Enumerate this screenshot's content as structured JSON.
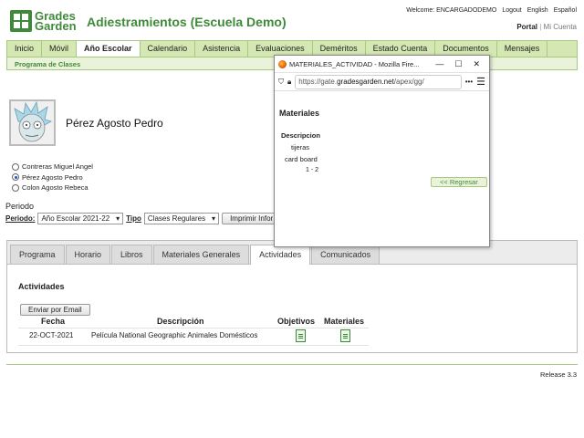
{
  "header": {
    "logo_line1": "Grades",
    "logo_line2": "Garden",
    "title": "Adiestramientos (Escuela Demo)",
    "welcome": "Welcome: ENCARGADODEMO",
    "logout": "Logout",
    "english": "English",
    "espanol": "Español",
    "portal": "Portal",
    "mi_cuenta": "Mi Cuenta"
  },
  "nav": {
    "tabs": [
      "Inicio",
      "Móvil",
      "Año Escolar",
      "Calendario",
      "Asistencia",
      "Evaluaciones",
      "Deméritos",
      "Estado Cuenta",
      "Documentos",
      "Mensajes"
    ],
    "active": "Año Escolar",
    "subnav": "Programa de Clases"
  },
  "student": {
    "name": "Pérez Agosto Pedro",
    "options": [
      {
        "label": "Contreras Miguel Angel",
        "selected": false
      },
      {
        "label": "Pérez Agosto Pedro",
        "selected": true
      },
      {
        "label": "Colon Agosto Rebeca",
        "selected": false
      }
    ]
  },
  "periodo": {
    "title": "Periodo",
    "label": "Periodo:",
    "value": "Año Escolar 2021-22",
    "tipo_label": "Tipo",
    "tipo_value": "Clases Regulares",
    "print_button": "Imprimir Infor"
  },
  "content_tabs": {
    "items": [
      "Programa",
      "Horario",
      "Libros",
      "Materiales Generales",
      "Actividades",
      "Comunicados"
    ],
    "active": "Actividades"
  },
  "actividades": {
    "title": "Actividades",
    "email_button": "Enviar por Email",
    "columns": [
      "Fecha",
      "Descripción",
      "Objetivos",
      "Materiales"
    ],
    "rows": [
      {
        "fecha": "22-OCT-2021",
        "descripcion": "Película National Geographic Animales Domésticos"
      }
    ]
  },
  "footer": {
    "release": "Release 3.3"
  },
  "popup": {
    "window_title": "MATERIALES_ACTIVIDAD - Mozilla Fire...",
    "url_prefix": "https://gate.",
    "url_domain": "gradesgarden.net",
    "url_suffix": "/apex/gg/",
    "heading": "Materiales",
    "desc_header": "Descripcion",
    "items": [
      "tijeras",
      "card board"
    ],
    "pagination": "1 - 2",
    "back_button": "<< Regresar"
  },
  "colors": {
    "brand_green": "#3f8a3a",
    "nav_bg": "#d5e8b3"
  }
}
